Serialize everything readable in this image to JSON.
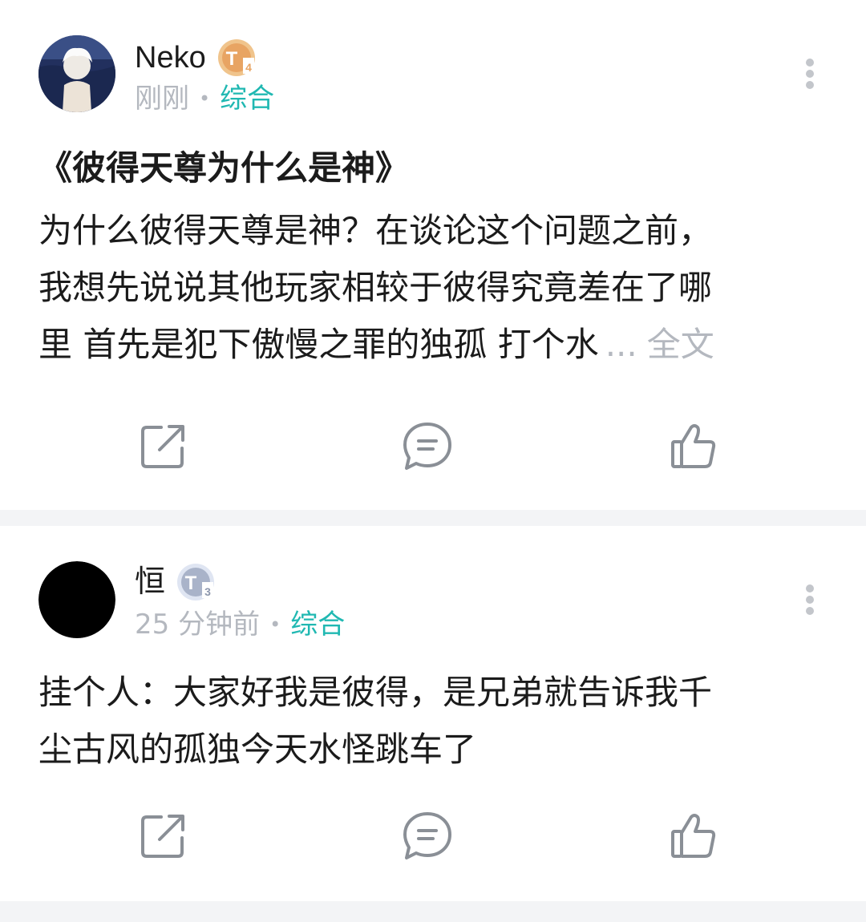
{
  "posts": [
    {
      "author": "Neko",
      "badge_icon": "gold-level-badge-icon",
      "time": "刚刚",
      "category": "综合",
      "title": "《彼得天尊为什么是神》",
      "content_lines": [
        "为什么彼得天尊是神？在谈论这个问题之前，",
        "我想先说说其他玩家相较于彼得究竟差在了哪",
        "里 首先是犯下傲慢之罪的独孤 打个水"
      ],
      "ellipsis": "...",
      "full_text_label": "全文",
      "actions": {
        "share_icon": "share-icon",
        "comment_icon": "comment-icon",
        "like_icon": "thumbs-up-icon"
      }
    },
    {
      "author": "恒",
      "badge_icon": "silver-level-badge-icon",
      "time": "25 分钟前",
      "category": "综合",
      "content_lines": [
        "挂个人：大家好我是彼得，是兄弟就告诉我千",
        "尘古风的孤独今天水怪跳车了"
      ],
      "actions": {
        "share_icon": "share-icon",
        "comment_icon": "comment-icon",
        "like_icon": "thumbs-up-icon"
      }
    }
  ],
  "colors": {
    "accent": "#20b8b2",
    "muted": "#b4b8bf",
    "text": "#1b1b1b",
    "separator": "#f3f4f6",
    "icon": "#8a8f96"
  }
}
